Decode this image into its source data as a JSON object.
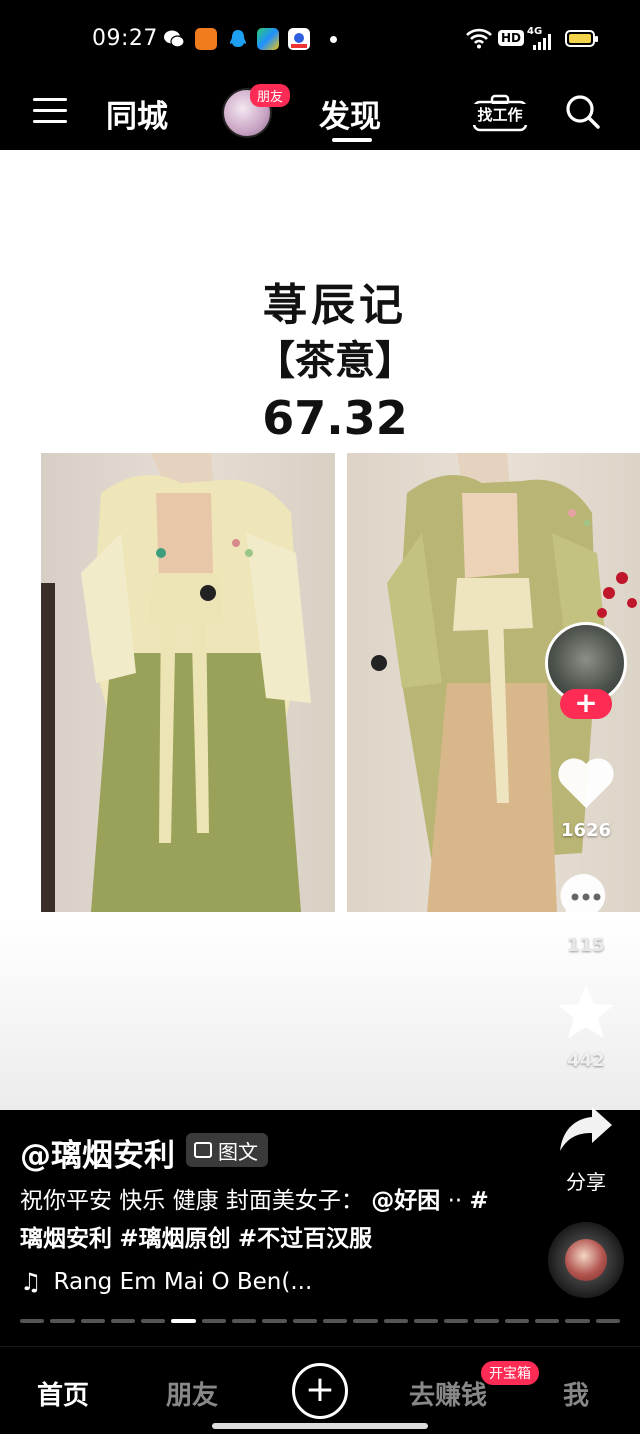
{
  "status_bar": {
    "time": "09:27",
    "hd_label": "HD",
    "network_label": "4G",
    "icons": [
      "wechat-icon",
      "uc-browser-icon",
      "qq-icon",
      "video-app-icon",
      "baidu-icon",
      "more-dot-icon",
      "wifi-icon",
      "signal-icon",
      "battery-icon"
    ]
  },
  "top_nav": {
    "city_tab": "同城",
    "friend_badge": "朋友",
    "discover_tab": "发现",
    "job_label": "找工作"
  },
  "post": {
    "title_line1": "荨辰记",
    "title_line2": "【茶意】",
    "title_line3": "67.32"
  },
  "actions": {
    "follow_label": "+",
    "likes": "1626",
    "comments": "115",
    "favorites": "442",
    "share_label": "分享"
  },
  "info": {
    "author": "@璃烟安利",
    "tag_label": "图文",
    "caption_text": "祝你平安 快乐 健康 封面美女子：",
    "caption_mention": "@好困",
    "caption_sep": "··",
    "hashtags": [
      "#璃烟安利",
      "#璃烟原创",
      "#不过百汉服"
    ],
    "music": "Rang Em Mai O Ben(...",
    "progress": {
      "total": 20,
      "current": 6
    }
  },
  "tab_bar": {
    "home": "首页",
    "friends": "朋友",
    "create": "+",
    "earn": "去赚钱",
    "earn_badge": "开宝箱",
    "me": "我"
  },
  "colors": {
    "accent": "#fe2c55",
    "background": "#000000"
  }
}
